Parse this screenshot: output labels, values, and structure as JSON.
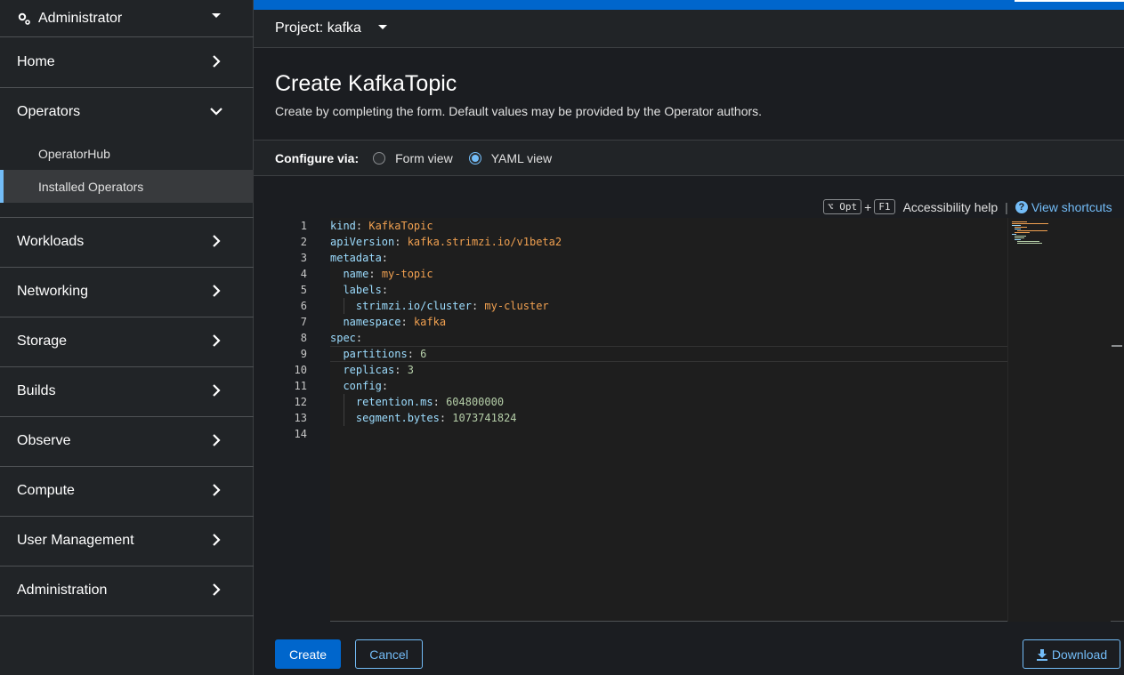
{
  "sidebar": {
    "perspective": "Administrator",
    "sections": [
      {
        "label": "Home",
        "expanded": false
      },
      {
        "label": "Operators",
        "expanded": true,
        "items": [
          {
            "label": "OperatorHub",
            "active": false
          },
          {
            "label": "Installed Operators",
            "active": true
          }
        ]
      },
      {
        "label": "Workloads",
        "expanded": false
      },
      {
        "label": "Networking",
        "expanded": false
      },
      {
        "label": "Storage",
        "expanded": false
      },
      {
        "label": "Builds",
        "expanded": false
      },
      {
        "label": "Observe",
        "expanded": false
      },
      {
        "label": "Compute",
        "expanded": false
      },
      {
        "label": "User Management",
        "expanded": false
      },
      {
        "label": "Administration",
        "expanded": false
      }
    ]
  },
  "project": {
    "label": "Project: kafka"
  },
  "page": {
    "title": "Create KafkaTopic",
    "description": "Create by completing the form. Default values may be provided by the Operator authors."
  },
  "configure": {
    "label": "Configure via:",
    "options": [
      {
        "label": "Form view",
        "checked": false
      },
      {
        "label": "YAML view",
        "checked": true
      }
    ]
  },
  "shortcuts": {
    "key1": "⌥ Opt",
    "plus": "+",
    "key2": "F1",
    "accessibility": "Accessibility help",
    "divider": "|",
    "view_shortcuts": "View shortcuts"
  },
  "editor": {
    "line_numbers": [
      "1",
      "2",
      "3",
      "4",
      "5",
      "6",
      "7",
      "8",
      "9",
      "10",
      "11",
      "12",
      "13",
      "14"
    ],
    "current_line": 9,
    "lines": [
      {
        "indent": 0,
        "key": "kind",
        "value": "KafkaTopic",
        "vtype": "s"
      },
      {
        "indent": 0,
        "key": "apiVersion",
        "value": "kafka.strimzi.io/v1beta2",
        "vtype": "s"
      },
      {
        "indent": 0,
        "key": "metadata",
        "value": "",
        "vtype": ""
      },
      {
        "indent": 1,
        "key": "name",
        "value": "my-topic",
        "vtype": "s"
      },
      {
        "indent": 1,
        "key": "labels",
        "value": "",
        "vtype": ""
      },
      {
        "indent": 2,
        "key": "strimzi.io/cluster",
        "value": "my-cluster",
        "vtype": "s"
      },
      {
        "indent": 1,
        "key": "namespace",
        "value": "kafka",
        "vtype": "s"
      },
      {
        "indent": 0,
        "key": "spec",
        "value": "",
        "vtype": ""
      },
      {
        "indent": 1,
        "key": "partitions",
        "value": "6",
        "vtype": "n"
      },
      {
        "indent": 1,
        "key": "replicas",
        "value": "3",
        "vtype": "n"
      },
      {
        "indent": 1,
        "key": "config",
        "value": "",
        "vtype": ""
      },
      {
        "indent": 2,
        "key": "retention.ms",
        "value": "604800000",
        "vtype": "n"
      },
      {
        "indent": 2,
        "key": "segment.bytes",
        "value": "1073741824",
        "vtype": "n"
      },
      {
        "indent": 0,
        "key": "",
        "value": "",
        "vtype": ""
      }
    ]
  },
  "actions": {
    "create": "Create",
    "cancel": "Cancel",
    "download": "Download"
  },
  "colors": {
    "accent": "#0066cc",
    "link": "#73bcf7",
    "yaml_key": "#9cdcfe",
    "yaml_string": "#f0a050",
    "yaml_number": "#b5cea8"
  }
}
